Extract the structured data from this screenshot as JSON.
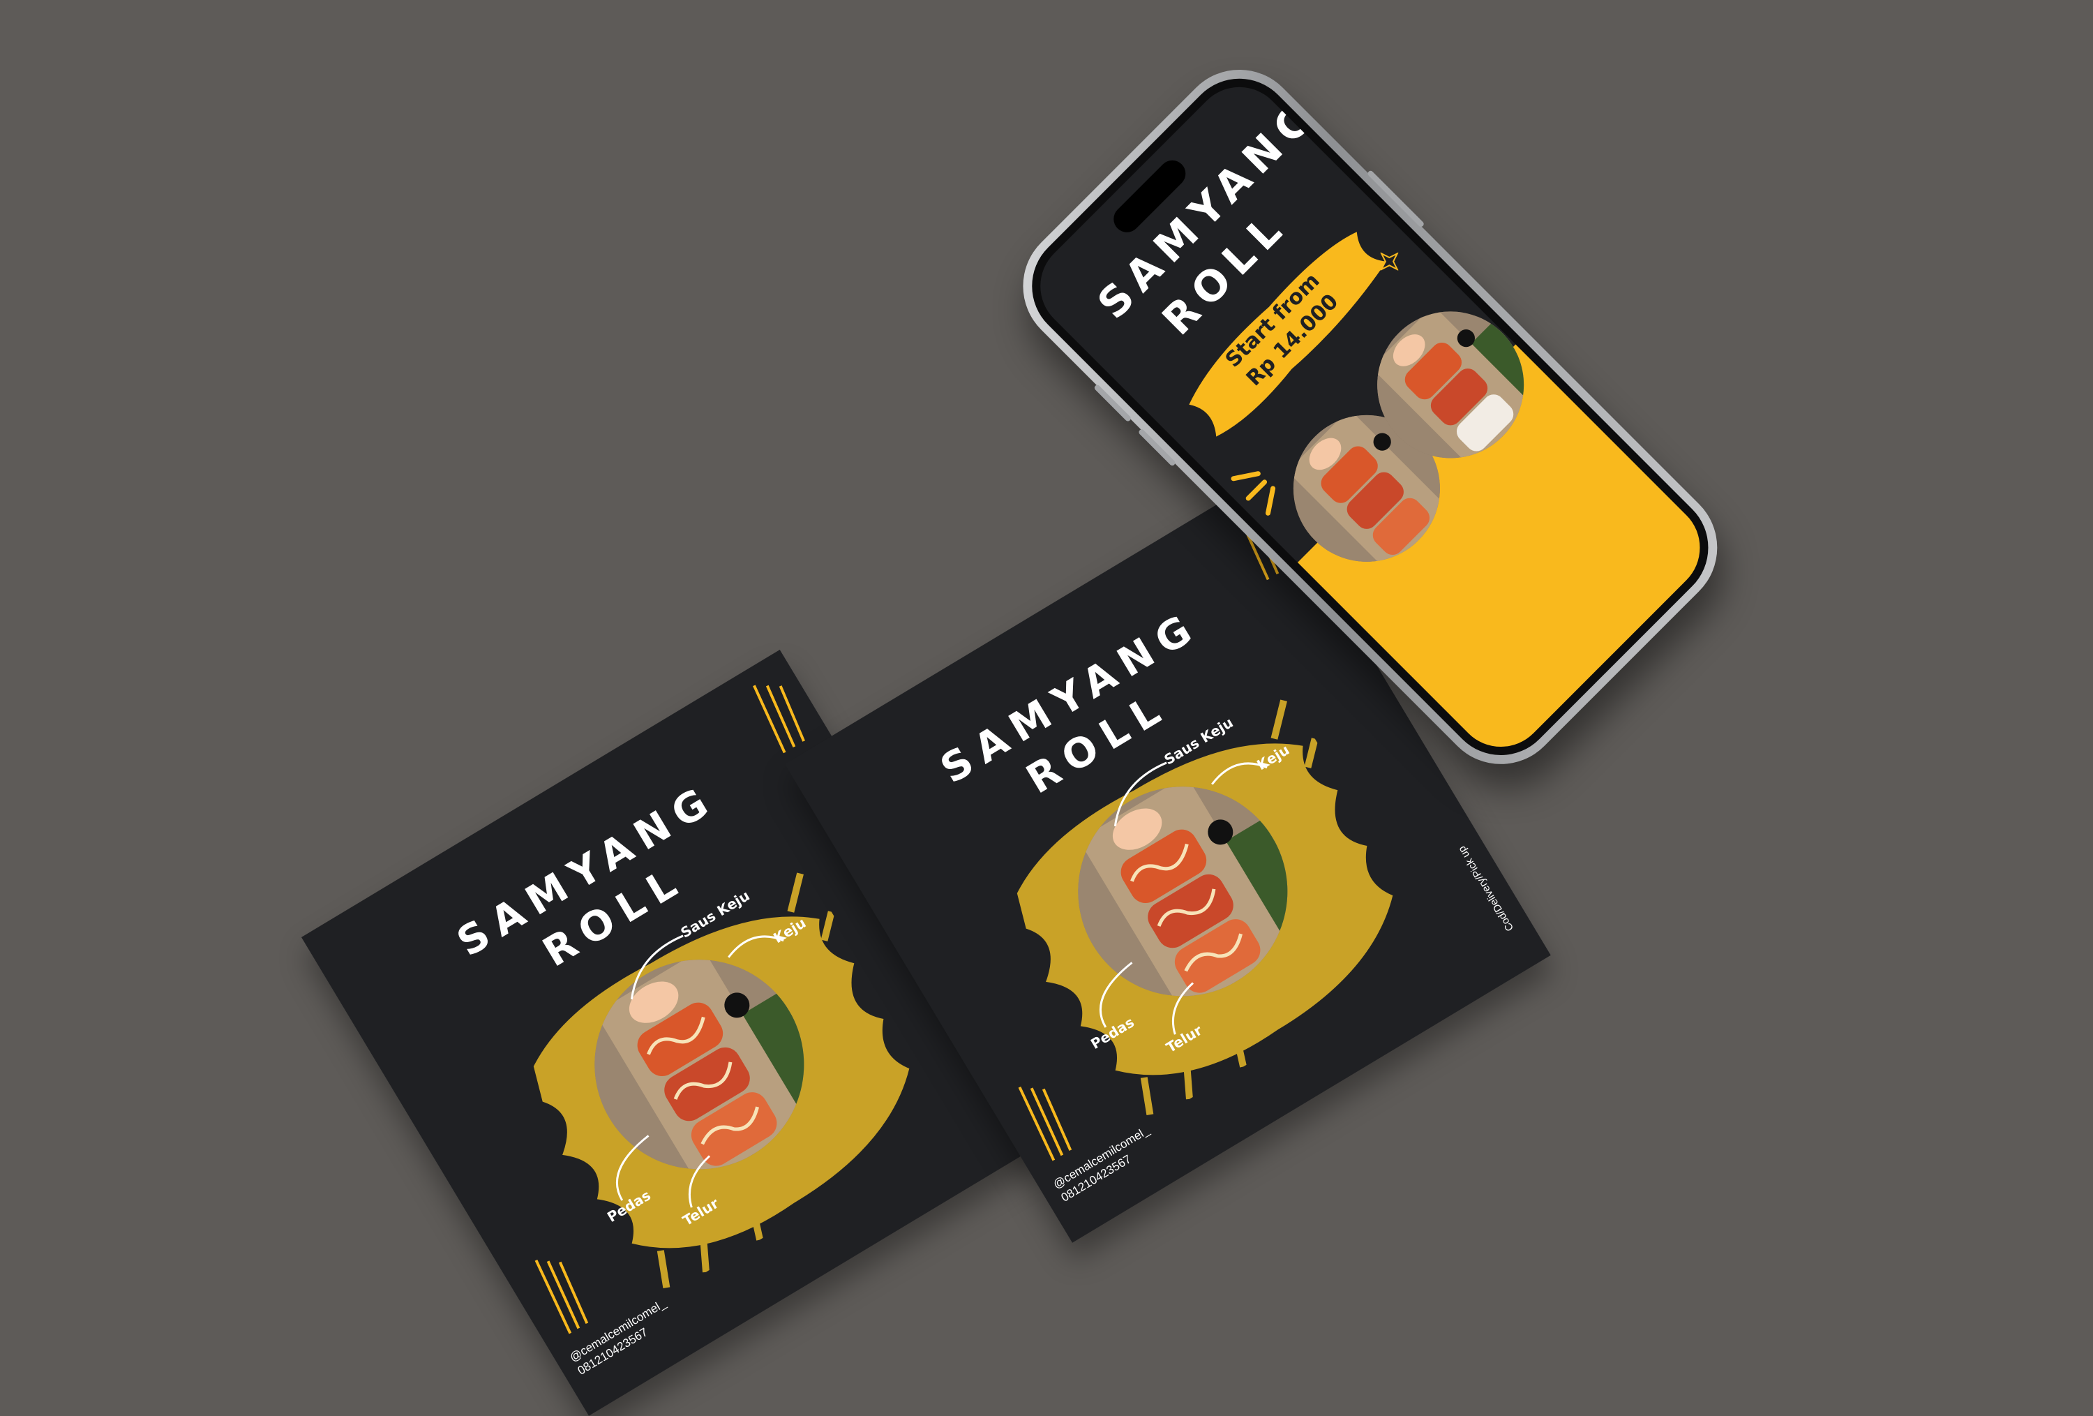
{
  "flyer": {
    "title_line1": "SAMYANG",
    "title_line2": "ROLL",
    "label_saus_keju": "Saus Keju",
    "label_keju": "Keju",
    "label_pedas": "Pedas",
    "label_telur": "Telur",
    "handle": "@cemalcemilcomel_",
    "phone_number": "081210423567",
    "service": "Cod/Delivery/Pick up"
  },
  "phone": {
    "title_line1": "SAMYANG",
    "title_line2": "ROLL",
    "price_line1": "Start from",
    "price_line2": "Rp 14.000"
  },
  "colors": {
    "background": "#5e5b58",
    "card": "#1f2023",
    "accent_yellow": "#f9b91d",
    "brush_gold": "#c9a227"
  }
}
